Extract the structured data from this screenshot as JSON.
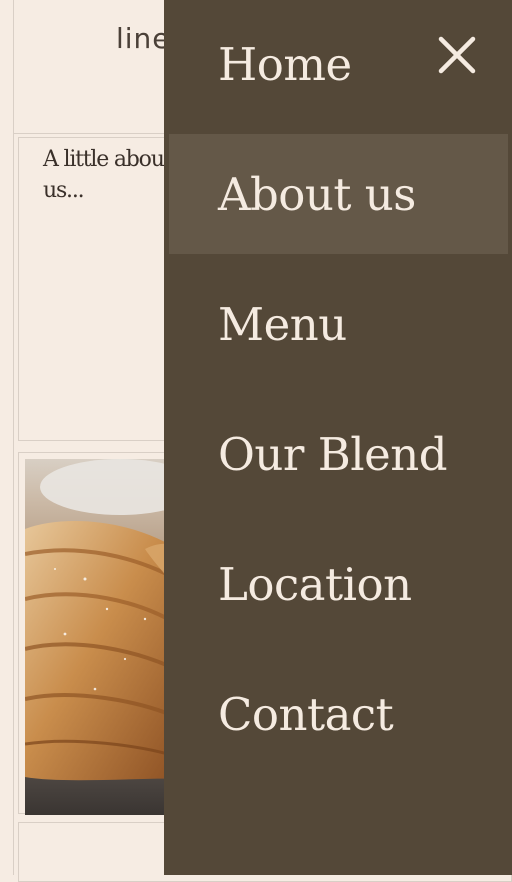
{
  "page": {
    "header_text": "line",
    "about_heading": "A little about us..."
  },
  "menu": {
    "close_icon": "close-icon",
    "active_index": 1,
    "items": [
      {
        "label": "Home"
      },
      {
        "label": "About us"
      },
      {
        "label": "Menu"
      },
      {
        "label": "Our Blend"
      },
      {
        "label": "Location"
      },
      {
        "label": "Contact"
      }
    ]
  },
  "colors": {
    "page_background": "#f6ece3",
    "drawer_background": "#544838",
    "drawer_active": "#645848",
    "drawer_text": "#f5ebe1",
    "body_text": "#3a302a"
  }
}
